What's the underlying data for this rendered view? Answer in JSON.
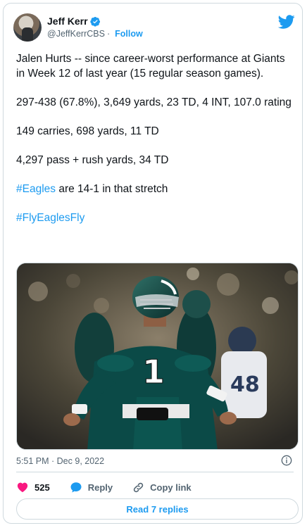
{
  "tweet": {
    "author": {
      "name": "Jeff Kerr",
      "handle": "@JeffKerrCBS",
      "separator": "·",
      "follow_label": "Follow"
    },
    "text": {
      "p1": "Jalen Hurts -- since career-worst performance at Giants in Week 12 of last year (15 regular season games).",
      "p2": "297-438 (67.8%), 3,649 yards, 23 TD, 4 INT, 107.0 rating",
      "p3": "149 carries, 698 yards, 11 TD",
      "p4": "4,297 pass + rush yards, 34 TD",
      "p5_hashtag": "#Eagles",
      "p5_rest": " are 14-1 in that stretch",
      "p6_hashtag": "#FlyEaglesFly"
    },
    "timestamp": "5:51 PM · Dec 9, 2022",
    "actions": {
      "like_count": "525",
      "reply_label": "Reply",
      "copy_link_label": "Copy link"
    },
    "read_replies_label": "Read 7 replies",
    "colors": {
      "accent": "#1d9bf0",
      "like": "#f91880",
      "text": "#0f1419",
      "secondary": "#536471",
      "border": "#cfd9de",
      "jersey_green": "#0b4a47"
    },
    "photo": {
      "jersey_number": "1",
      "background_jersey_number": "48"
    }
  }
}
